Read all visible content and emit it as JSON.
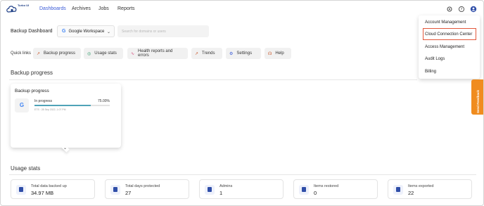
{
  "app": {
    "logo_text": "Turbo UI"
  },
  "nav": {
    "items": [
      {
        "label": "Dashboards",
        "active": true
      },
      {
        "label": "Archives",
        "active": false
      },
      {
        "label": "Jobs",
        "active": false
      },
      {
        "label": "Reports",
        "active": false
      }
    ]
  },
  "top_icons": [
    "gear-icon",
    "help-icon",
    "user-icon"
  ],
  "header": {
    "title": "Backup Dashboard",
    "workspace_select": "Google Workspace",
    "search_placeholder": "Search for domains or users"
  },
  "quick_links": {
    "label": "Quick links",
    "items": [
      {
        "label": "Backup progress",
        "icon": "trend-icon"
      },
      {
        "label": "Usage stats",
        "icon": "usage-icon"
      },
      {
        "label": "Health reports and errors",
        "icon": "pulse-icon"
      },
      {
        "label": "Trends",
        "icon": "trend-icon"
      },
      {
        "label": "Settings",
        "icon": "gear-icon"
      },
      {
        "label": "Help",
        "icon": "headset-icon"
      }
    ]
  },
  "backup_progress": {
    "section_title": "Backup progress",
    "card": {
      "title": "Backup progress",
      "status": "In progress",
      "percent_text": "75.00%",
      "percent": 0.75,
      "eta": "ETS : 28 Sep 2022, 1:07 PM"
    }
  },
  "usage_stats": {
    "section_title": "Usage stats",
    "items": [
      {
        "label": "Total data backed up",
        "value": "34.97 MB"
      },
      {
        "label": "Total days protected",
        "value": "27"
      },
      {
        "label": "Admins",
        "value": "1"
      },
      {
        "label": "Items restored",
        "value": "0"
      },
      {
        "label": "Items exported",
        "value": "22"
      }
    ]
  },
  "account_menu": {
    "items": [
      {
        "label": "Account Management"
      },
      {
        "label": "Cloud Connection Center",
        "highlighted": true
      },
      {
        "label": "Access Management"
      },
      {
        "label": "Audit Logs"
      },
      {
        "label": "Billing"
      }
    ]
  },
  "feedback_tab": {
    "label": "Send Feedback"
  },
  "colors": {
    "accent": "#3a5bd8",
    "highlight": "#e2583b",
    "feedback": "#f08c1f",
    "progress": "#4fa3b8"
  }
}
